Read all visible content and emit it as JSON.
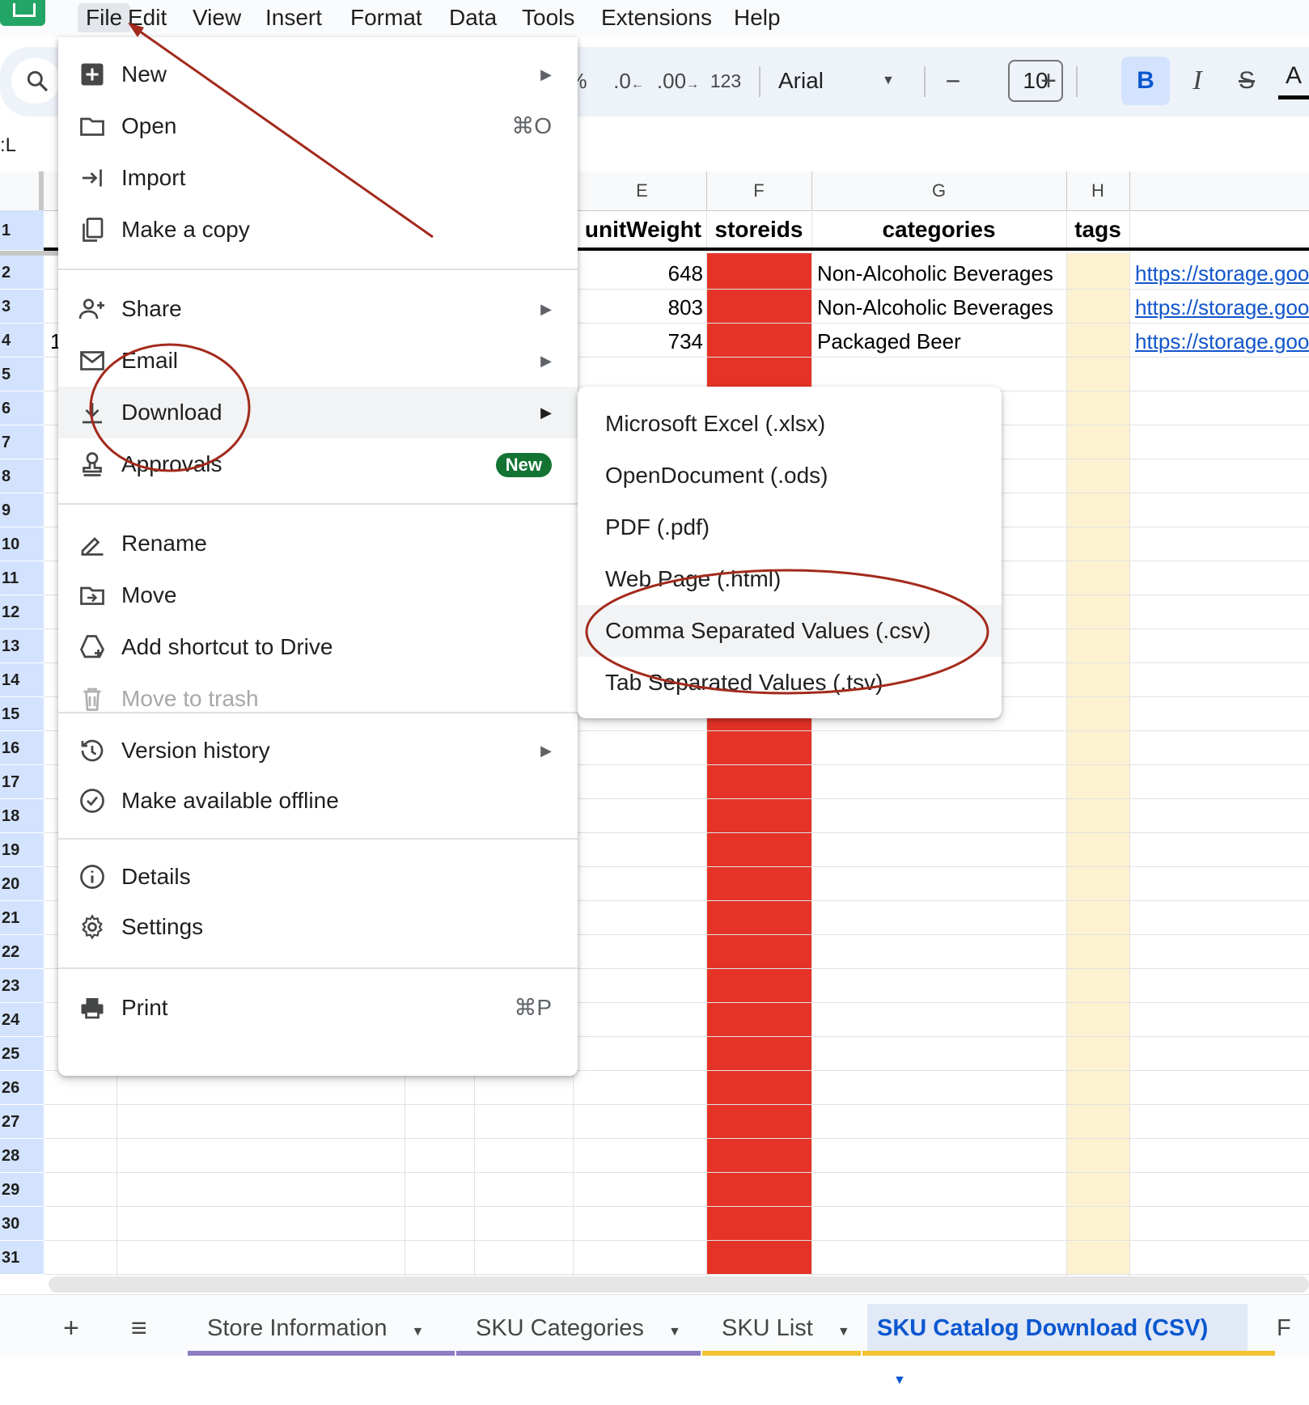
{
  "menubar": {
    "items": [
      "File",
      "Edit",
      "View",
      "Insert",
      "Format",
      "Data",
      "Tools",
      "Extensions",
      "Help"
    ]
  },
  "toolbar": {
    "percent": "%",
    "decrease_decimal": ".0",
    "increase_decimal": ".00",
    "number_format": "123",
    "font_name": "Arial",
    "font_size": "10",
    "minus": "−",
    "plus": "+",
    "bold": "B",
    "italic": "I",
    "strike": "S",
    "text_color": "A"
  },
  "name_box": ":L",
  "columns": {
    "E": "E",
    "F": "F",
    "G": "G",
    "H": "H"
  },
  "header_row": {
    "unitWeight": "unitWeight",
    "storeids": "storeids",
    "categories": "categories",
    "tags": "tags"
  },
  "row_numbers": [
    "1",
    "2",
    "3",
    "4",
    "5",
    "6",
    "7",
    "8",
    "9",
    "10",
    "11",
    "12",
    "13",
    "14",
    "15",
    "16",
    "17",
    "18",
    "19",
    "20",
    "21",
    "22",
    "23",
    "24",
    "25",
    "26",
    "27",
    "28",
    "29",
    "30",
    "31"
  ],
  "rows": [
    {
      "unitWeight": "648",
      "categories": "Non-Alcoholic Beverages",
      "link": "https://storage.goo"
    },
    {
      "unitWeight": "803",
      "categories": "Non-Alcoholic Beverages",
      "link": "https://storage.goo"
    },
    {
      "unitWeight": "734",
      "categories": "Packaged Beer",
      "link": "https://storage.goo"
    }
  ],
  "row4_partial": "1",
  "file_menu": {
    "new": "New",
    "open": "Open",
    "open_shortcut": "⌘O",
    "import": "Import",
    "make_copy": "Make a copy",
    "share": "Share",
    "email": "Email",
    "download": "Download",
    "approvals": "Approvals",
    "approvals_badge": "New",
    "rename": "Rename",
    "move": "Move",
    "add_shortcut": "Add shortcut to Drive",
    "move_to_trash": "Move to trash",
    "version_history": "Version history",
    "offline": "Make available offline",
    "details": "Details",
    "settings": "Settings",
    "print": "Print",
    "print_shortcut": "⌘P"
  },
  "download_menu": {
    "xlsx": "Microsoft Excel (.xlsx)",
    "ods": "OpenDocument (.ods)",
    "pdf": "PDF (.pdf)",
    "html": "Web Page (.html)",
    "csv": "Comma Separated Values (.csv)",
    "tsv": "Tab Separated Values (.tsv)"
  },
  "sheet_tabs": {
    "add": "+",
    "all_sheets": "≡",
    "tabs": [
      "Store Information",
      "SKU Categories",
      "SKU List",
      "SKU Catalog Download (CSV)"
    ],
    "overflow": "F"
  },
  "colors": {
    "red_column": "#e63327",
    "tags_column": "#fcf2d2",
    "annotation": "#a32a1c",
    "active_tab": "#0b57d0",
    "badge": "#137333"
  }
}
